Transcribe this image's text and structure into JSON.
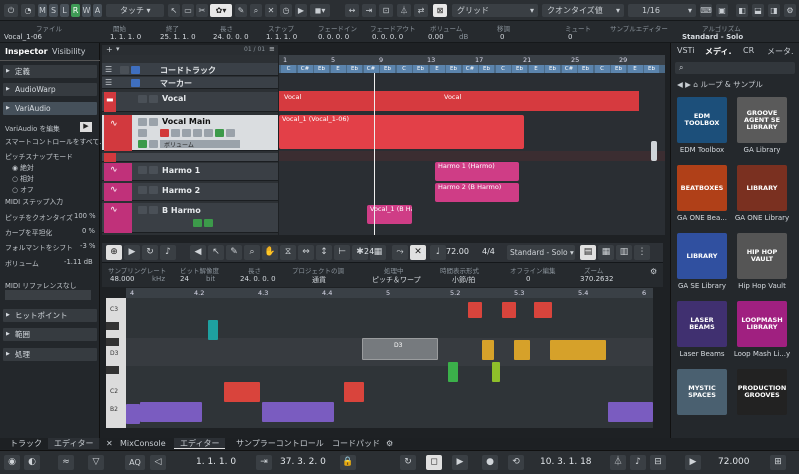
{
  "toolbar": {
    "mode_buttons": [
      "M",
      "S",
      "L",
      "R",
      "W",
      "A"
    ],
    "automation": "タッチ",
    "grid": "グリッド",
    "quantize": "クオンタイズ値",
    "quant_value": "1/16"
  },
  "infobar": {
    "labels": [
      "ファイル",
      "開始",
      "終了",
      "長さ",
      "スナップ",
      "フェードイン",
      "フェードアウト",
      "ボリューム",
      "移調",
      "ミュート",
      "サンプルエディター",
      "アルゴリズム"
    ],
    "values": [
      "Vocal_1-06",
      "1. 1. 1. 0",
      "25. 1. 1. 0",
      "24. 0. 0. 0",
      "1. 1. 1. 0",
      "0. 0. 0. 0",
      "0. 0. 0. 0",
      "0.00",
      "0",
      "0",
      "",
      "Standard - Solo"
    ]
  },
  "inspector": {
    "tab1": "Inspector",
    "tab2": "Visibility",
    "sections": [
      "定義",
      "AudioWarp",
      "VariAudio"
    ],
    "lines": [
      "VariAudio を編集",
      "スマートコントロールをすべて..",
      "ピッチスナップモード",
      "絶対",
      "相対",
      "オフ",
      "MIDI ステップ入力",
      "ピッチをクオンタイズ",
      "カーブを平坦化",
      "フォルマントをシフト",
      "ボリューム",
      "MIDI リファレンスなし"
    ],
    "pct": [
      "100 %",
      "0 %",
      "-3 %",
      "-1.11 dB"
    ],
    "bottom": [
      "ヒットポイント",
      "範囲",
      "処理"
    ]
  },
  "tracks": {
    "counter": "01 / 01",
    "items": [
      {
        "name": "コードトラック"
      },
      {
        "name": "マーカー"
      },
      {
        "name": "Vocal"
      },
      {
        "name": "Vocal Main"
      },
      {
        "name": "ボリューム"
      },
      {
        "name": "Harmo 1"
      },
      {
        "name": "Harmo 2"
      },
      {
        "name": "B Harmo"
      }
    ]
  },
  "ruler": {
    "bars": [
      "1",
      "5",
      "9",
      "13",
      "17",
      "21",
      "25",
      "29"
    ]
  },
  "chords": [
    "C",
    "C#",
    "Eb",
    "E",
    "Eb",
    "C#",
    "Eb",
    "C",
    "Eb",
    "E",
    "Eb",
    "C#",
    "Eb",
    "C",
    "Eb",
    "E",
    "Eb",
    "C#",
    "Eb",
    "C",
    "Eb",
    "E",
    "Eb"
  ],
  "clips": {
    "vocal": "Vocal",
    "vocal2": "Vocal",
    "vocal_main": "Vocal_1 (Vocal_1-06)",
    "harmo1": "Harmo 1 (Harmo)",
    "harmo2": "Harmo 2 (B Harmo)",
    "bharmo": "Vocal_1 (B Ha"
  },
  "editor": {
    "bars": "24",
    "beats": "1",
    "tempo": "72.00",
    "sig": "4/4",
    "algo": "Standard - Solo",
    "labels": [
      "サンプリングレート",
      "ビット解像度",
      "長さ",
      "プロジェクトの調",
      "処理中",
      "時間表示形式",
      "オフライン編集",
      "ズーム"
    ],
    "values": [
      "48.000",
      "kHz",
      "24",
      "bit",
      "24. 0. 0. 0",
      "通貨",
      "ピッチ＆ワープ",
      "小節/拍",
      "0",
      "370.2632"
    ],
    "marks": [
      "4",
      "4.2",
      "4.3",
      "4.4",
      "5",
      "5.2",
      "5.3",
      "5.4",
      "6"
    ],
    "keys": [
      "C3",
      "C2",
      "B2",
      "D2"
    ],
    "note_label": "D3"
  },
  "mediabay": {
    "tabs": [
      "VSTi",
      "メディ.",
      "CR",
      "メータ."
    ],
    "breadcrumb": "ループ & サンプル",
    "tiles": [
      {
        "label": "EDM Toolbox",
        "art": "EDM TOOLBOX",
        "color": "#1c4f7a"
      },
      {
        "label": "GA Library",
        "art": "GROOVE AGENT SE LIBRARY",
        "color": "#5a5a5a"
      },
      {
        "label": "GA ONE Bea...",
        "art": "BEATBOXES",
        "color": "#b04018"
      },
      {
        "label": "GA ONE Library",
        "art": "LIBRARY",
        "color": "#7a3020"
      },
      {
        "label": "GA SE Library",
        "art": "LIBRARY",
        "color": "#3050a0"
      },
      {
        "label": "Hip Hop Vault",
        "art": "HIP HOP VAULT",
        "color": "#555"
      },
      {
        "label": "Laser Beams",
        "art": "LASER BEAMS",
        "color": "#403070"
      },
      {
        "label": "Loop Mash Li...y",
        "art": "LOOPMASH LIBRARY",
        "color": "#a02080"
      },
      {
        "label": "",
        "art": "MYSTIC SPACES",
        "color": "#4a6070"
      },
      {
        "label": "",
        "art": "PRODUCTION GROOVES",
        "color": "#222"
      }
    ]
  },
  "bottom": {
    "tabs": [
      "トラック",
      "エディター",
      "MixConsole",
      "エディター",
      "サンプラーコントロール",
      "コードパッド"
    ]
  },
  "transport": {
    "aq": "AQ",
    "pos1": "1. 1. 1. 0",
    "pos2": "37. 3. 2. 0",
    "pos3": "10. 3. 1. 18",
    "tempo": "72.000"
  }
}
